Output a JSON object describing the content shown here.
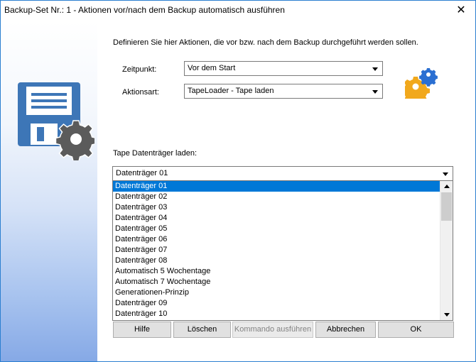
{
  "window": {
    "title": "Backup-Set Nr.: 1 - Aktionen vor/nach dem Backup automatisch ausführen",
    "close_glyph": "✕"
  },
  "intro_text": "Definieren Sie hier Aktionen, die vor bzw. nach dem Backup durchgeführt werden sollen.",
  "zeitpunkt": {
    "label": "Zeitpunkt:",
    "value": "Vor dem Start"
  },
  "aktionsart": {
    "label": "Aktionsart:",
    "value": "TapeLoader - Tape laden"
  },
  "tape": {
    "label": "Tape Datenträger laden:",
    "value": "Datenträger 01",
    "items": [
      "Datenträger 01",
      "Datenträger 02",
      "Datenträger 03",
      "Datenträger 04",
      "Datenträger 05",
      "Datenträger 06",
      "Datenträger 07",
      "Datenträger 08",
      "Automatisch 5 Wochentage",
      "Automatisch 7 Wochentage",
      "Generationen-Prinzip",
      "Datenträger 09",
      "Datenträger 10"
    ],
    "selected_index": 0
  },
  "buttons": {
    "hilfe": "Hilfe",
    "loeschen": "Löschen",
    "kommando": "Kommando ausführen",
    "abbrechen": "Abbrechen",
    "ok": "OK"
  },
  "colors": {
    "selection": "#0078d7",
    "accent_blue": "#3d76b7",
    "gear_gray": "#5b5b5b",
    "gear_orange": "#f1a81c",
    "gear_blue": "#2a6fd2"
  },
  "icons": {
    "main": "floppy-disk-gear-icon",
    "action": "gears-icon"
  }
}
